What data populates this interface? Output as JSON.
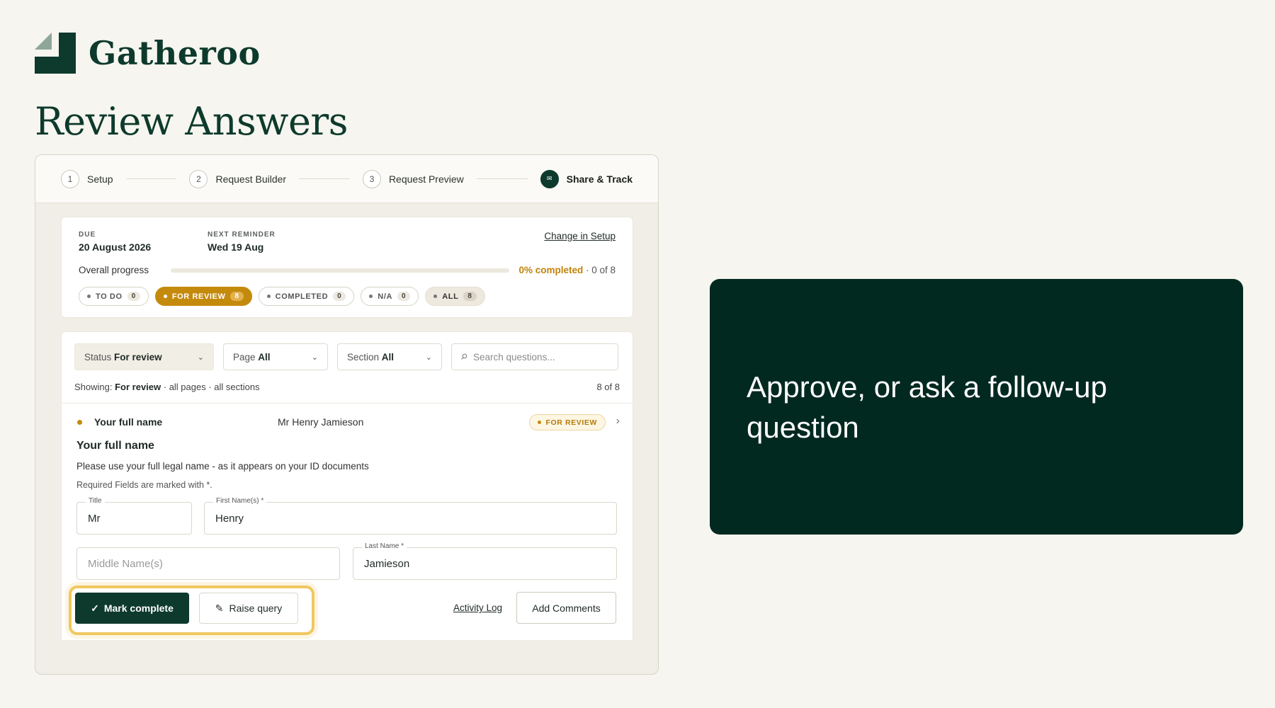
{
  "brand": {
    "name": "Gatheroo"
  },
  "page": {
    "title": "Review Answers"
  },
  "stepper": {
    "steps": [
      {
        "num": "1",
        "label": "Setup"
      },
      {
        "num": "2",
        "label": "Request Builder"
      },
      {
        "num": "3",
        "label": "Request Preview"
      },
      {
        "num": "✉",
        "label": "Share & Track"
      }
    ]
  },
  "summary": {
    "due_label": "DUE",
    "due_value": "20 August 2026",
    "reminder_label": "NEXT REMINDER",
    "reminder_value": "Wed 19 Aug",
    "change_link": "Change in Setup",
    "progress_label": "Overall progress",
    "progress_fraction": 0,
    "progress_pct": "0% completed",
    "progress_count": " · 0 of 8",
    "chips": [
      {
        "label": "TO DO",
        "count": "0"
      },
      {
        "label": "FOR REVIEW",
        "count": "8"
      },
      {
        "label": "COMPLETED",
        "count": "0"
      },
      {
        "label": "N/A",
        "count": "0"
      },
      {
        "label": "ALL",
        "count": "8"
      }
    ]
  },
  "filters": {
    "status_label": "Status",
    "status_value": "For review",
    "page_label": "Page",
    "page_value": "All",
    "section_label": "Section",
    "section_value": "All",
    "search_placeholder": "Search questions...",
    "showing_prefix": "Showing:",
    "showing_status": "For review",
    "showing_suffix": " · all pages · all sections",
    "count": "8 of 8"
  },
  "question": {
    "row_name": "Your full name",
    "row_answer": "Mr Henry Jamieson",
    "badge": "FOR REVIEW",
    "title": "Your full name",
    "description": "Please use your full legal name - as it appears on your ID documents",
    "required_note": "Required Fields are marked with *.",
    "fields": {
      "title_label": "Title",
      "title_value": "Mr",
      "first_label": "First Name(s) *",
      "first_value": "Henry",
      "middle_placeholder": "Middle Name(s)",
      "last_label": "Last Name *",
      "last_value": "Jamieson"
    }
  },
  "actions": {
    "mark_complete": "Mark complete",
    "raise_query": "Raise query",
    "activity_log": "Activity Log",
    "add_comments": "Add Comments"
  },
  "callout": {
    "text": "Approve, or ask a follow-up question"
  },
  "colors": {
    "brand_green": "#0d3a2c",
    "accent_amber": "#c48a0c",
    "callout_bg": "#022920",
    "highlight": "#f0c860"
  }
}
